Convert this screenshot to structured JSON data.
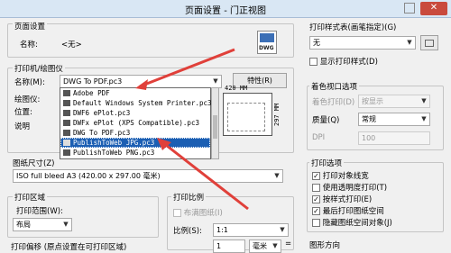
{
  "window": {
    "title": "页面设置 - 门正视图",
    "close": "✕"
  },
  "page_setup": {
    "section": "页面设置",
    "name_label": "名称:",
    "name_value": "<无>"
  },
  "plotter": {
    "section": "打印机/绘图仪",
    "name_label": "名称(M):",
    "name_value": "DWG To PDF.pc3",
    "properties_btn": "特性(R)",
    "plotter_label": "绘图仪:",
    "location_label": "位置:",
    "desc_label": "说明",
    "dropdown": [
      "Adobe PDF",
      "Default Windows System Printer.pc3",
      "DWF6 ePlot.pc3",
      "DWFx ePlot (XPS Compatible).pc3",
      "DWG To PDF.pc3",
      "PublishToWeb JPG.pc3",
      "PublishToWeb PNG.pc3"
    ],
    "selected_index": 5,
    "preview_width": "420 MM",
    "preview_height": "297 MM"
  },
  "paper_size": {
    "section": "图纸尺寸(Z)",
    "value": "ISO full bleed A3 (420.00 x 297.00 毫米)"
  },
  "plot_area": {
    "section": "打印区域",
    "range_label": "打印范围(W):",
    "range_value": "布局"
  },
  "plot_offset": {
    "label": "打印偏移 (原点设置在可打印区域)"
  },
  "plot_scale": {
    "section": "打印比例",
    "fit_label": "布满图纸(I)",
    "scale_label": "比例(S):",
    "scale_value": "1:1",
    "amount": "1",
    "unit": "毫米",
    "eq": "="
  },
  "style_table": {
    "section": "打印样式表(画笔指定)(G)",
    "value": "无",
    "show_label": "显示打印样式(D)"
  },
  "shaded": {
    "section": "着色视口选项",
    "shade_label": "着色打印(D)",
    "shade_value": "按显示",
    "quality_label": "质量(Q)",
    "quality_value": "常规",
    "dpi_label": "DPI",
    "dpi_value": "100"
  },
  "plot_options": {
    "section": "打印选项",
    "items": [
      {
        "label": "打印对象线宽",
        "checked": true
      },
      {
        "label": "使用透明度打印(T)",
        "checked": false
      },
      {
        "label": "按样式打印(E)",
        "checked": true
      },
      {
        "label": "最后打印图纸空间",
        "checked": true
      },
      {
        "label": "隐藏图纸空间对象(J)",
        "checked": false
      }
    ]
  },
  "orientation": {
    "section": "图形方向"
  },
  "colors": {
    "accent": "#1c5fb3",
    "arrow": "#e0403a"
  }
}
